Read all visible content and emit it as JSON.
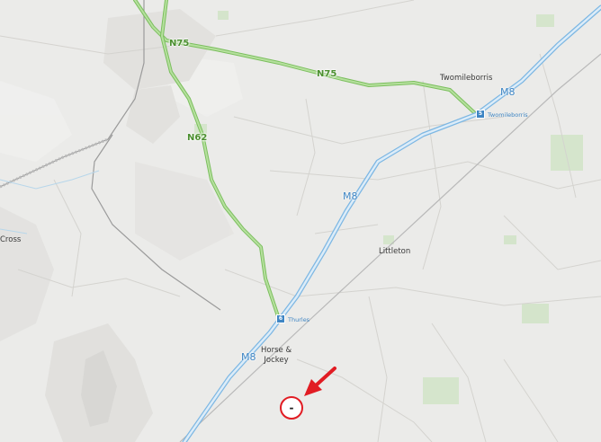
{
  "map": {
    "roads": {
      "n75_west": "N75",
      "n75_east": "N75",
      "n62": "N62",
      "m8_north": "M8",
      "m8_middle": "M8",
      "m8_south": "M8"
    },
    "places": {
      "twomileborris": "Twomileborris",
      "littleton": "Littleton",
      "horse_jockey": "Horse &\nJockey",
      "cross_west": "Cross"
    },
    "junctions": {
      "twomileborris": {
        "number": "5",
        "label": "Twomileborris"
      },
      "thurles": {
        "number": "6",
        "label": "Thurles"
      }
    },
    "marker": {
      "text": "-",
      "color": "#e11c23"
    },
    "colors": {
      "background": "#ebebe9",
      "national_road": "#8fcf71",
      "motorway": "#9fc9ea",
      "marker": "#e11c23"
    }
  }
}
